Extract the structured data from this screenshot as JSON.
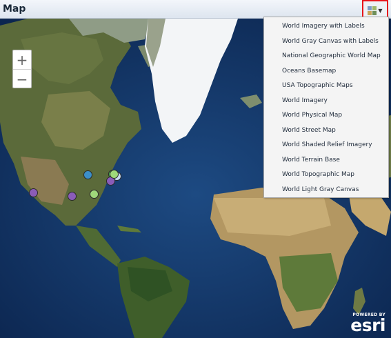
{
  "header": {
    "title": "Map"
  },
  "basemap_gallery": {
    "button_icon": "basemap-gallery-icon",
    "items": [
      "World Imagery with Labels",
      "World Gray Canvas with Labels",
      "National Geographic World Map",
      "Oceans Basemap",
      "USA Topographic Maps",
      "World Imagery",
      "World Physical Map",
      "World Street Map",
      "World Shaded Relief Imagery",
      "World Terrain Base",
      "World Topographic Map",
      "World Light Gray Canvas"
    ]
  },
  "zoom": {
    "in_label": "+",
    "out_label": "−"
  },
  "attribution": {
    "powered_by": "POWERED BY",
    "brand": "esri"
  },
  "map_markers": [
    {
      "color": "#8a5cb8"
    },
    {
      "color": "#8a5cb8"
    },
    {
      "color": "#3c8fc9"
    },
    {
      "color": "#9fd87a"
    },
    {
      "color": "#4fbf4f"
    },
    {
      "color": "#c6d8ef"
    },
    {
      "color": "#8a5cb8"
    },
    {
      "color": "#9fd87a"
    }
  ],
  "colors": {
    "highlight": "#e8141a",
    "ocean": "#0f2d57"
  }
}
